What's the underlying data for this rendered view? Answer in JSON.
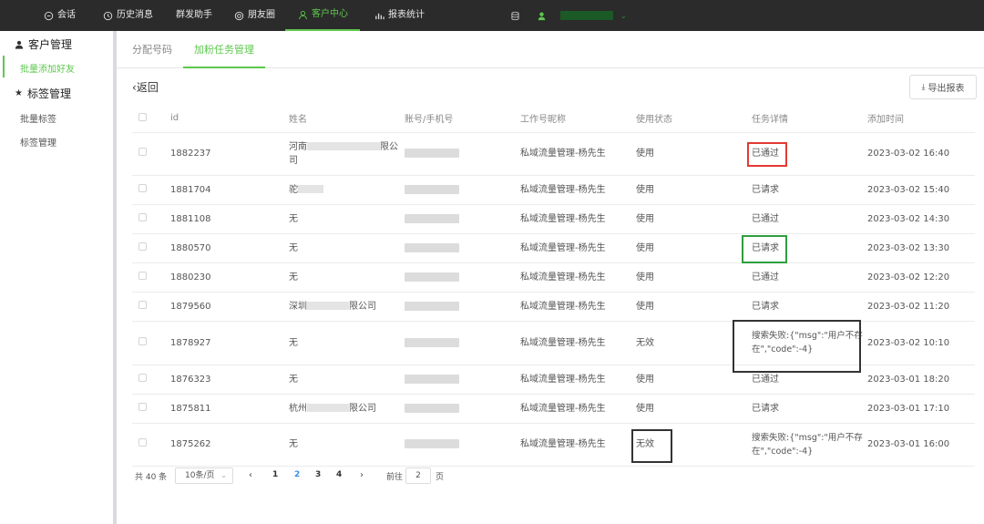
{
  "nav": {
    "items": [
      {
        "label": "会话",
        "icon": "chat-icon"
      },
      {
        "label": "历史消息",
        "icon": "clock-icon"
      },
      {
        "label": "群发助手",
        "icon": ""
      },
      {
        "label": "朋友圈",
        "icon": "moments-icon"
      },
      {
        "label": "客户中心",
        "icon": "user-icon",
        "active": true
      },
      {
        "label": "报表统计",
        "icon": "bar-chart-icon"
      }
    ],
    "accent": "#5ec84e",
    "bg": "#2b2b2b"
  },
  "sidebar": {
    "groups": [
      {
        "label": "客户管理",
        "icon": "person-icon",
        "items": [
          "批量添加好友"
        ]
      },
      {
        "label": "标签管理",
        "icon": "star-icon",
        "items": [
          "批量标签",
          "标签管理"
        ]
      }
    ]
  },
  "tabs": [
    {
      "label": "分配号码"
    },
    {
      "label": "加粉任务管理",
      "active": true
    }
  ],
  "back_label": "返回",
  "export_label": "导出报表",
  "table": {
    "columns": [
      "id",
      "姓名",
      "账号/手机号",
      "工作号昵称",
      "使用状态",
      "任务详情",
      "添加时间"
    ],
    "rows": [
      {
        "id": "1882237",
        "name_prefix": "河南",
        "name_suffix": "限公司",
        "worker": "私域流量管理-杨先生",
        "status": "使用",
        "detail": "已通过",
        "time": "2023-03-02 16:40"
      },
      {
        "id": "1881704",
        "name_prefix": "驼",
        "name_suffix": "",
        "worker": "私域流量管理-杨先生",
        "status": "使用",
        "detail": "已请求",
        "time": "2023-03-02 15:40"
      },
      {
        "id": "1881108",
        "name_prefix": "无",
        "name_suffix": "",
        "worker": "私域流量管理-杨先生",
        "status": "使用",
        "detail": "已通过",
        "time": "2023-03-02 14:30"
      },
      {
        "id": "1880570",
        "name_prefix": "无",
        "name_suffix": "",
        "worker": "私域流量管理-杨先生",
        "status": "使用",
        "detail": "已请求",
        "time": "2023-03-02 13:30"
      },
      {
        "id": "1880230",
        "name_prefix": "无",
        "name_suffix": "",
        "worker": "私域流量管理-杨先生",
        "status": "使用",
        "detail": "已通过",
        "time": "2023-03-02 12:20"
      },
      {
        "id": "1879560",
        "name_prefix": "深圳",
        "name_suffix": "限公司",
        "worker": "私域流量管理-杨先生",
        "status": "使用",
        "detail": "已请求",
        "time": "2023-03-02 11:20"
      },
      {
        "id": "1878927",
        "name_prefix": "无",
        "name_suffix": "",
        "worker": "私域流量管理-杨先生",
        "status": "无效",
        "detail": "搜索失败:{\"msg\":\"用户不存在\",\"code\":-4}",
        "time": "2023-03-02 10:10"
      },
      {
        "id": "1876323",
        "name_prefix": "无",
        "name_suffix": "",
        "worker": "私域流量管理-杨先生",
        "status": "使用",
        "detail": "已通过",
        "time": "2023-03-01 18:20"
      },
      {
        "id": "1875811",
        "name_prefix": "杭州",
        "name_suffix": "限公司",
        "worker": "私域流量管理-杨先生",
        "status": "使用",
        "detail": "已请求",
        "time": "2023-03-01 17:10"
      },
      {
        "id": "1875262",
        "name_prefix": "无",
        "name_suffix": "",
        "worker": "私域流量管理-杨先生",
        "status": "无效",
        "detail": "搜索失败:{\"msg\":\"用户不存在\",\"code\":-4}",
        "time": "2023-03-01 16:00"
      }
    ]
  },
  "pagination": {
    "total": "共 40 条",
    "page_size": "10条/页",
    "pages": [
      "1",
      "2",
      "3",
      "4"
    ],
    "current": "2",
    "goto_label": "前往",
    "goto_value": "2",
    "page_suffix": "页"
  },
  "highlight_colors": {
    "red": "#e53935",
    "green": "#2e9e3e",
    "dark": "#333333"
  }
}
